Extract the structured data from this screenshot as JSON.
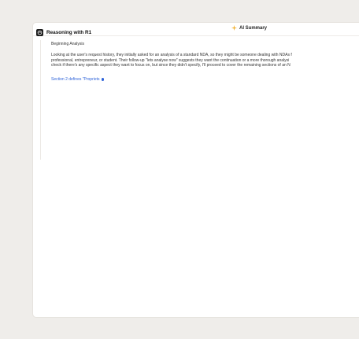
{
  "header": {
    "title": "AI Summary",
    "icon": "sparkle-icon",
    "icon_color": "#f2b233"
  },
  "reasoning": {
    "title": "Reasoning with R1",
    "icon": "deepseek-logo-icon",
    "step_title": "Beginning Analysis",
    "lines": [
      "Looking at the user's request history, they initially asked for an analysis of a standard NDA, so they might be someone dealing with NDAs f",
      "professional, entrepreneur, or student. Their follow-up \"lets analyse now\" suggests they want the continuation or a more thorough analysi",
      "check if there's any specific aspect they want to focus on, but since they didn't specify, I'll proceed to cover the remaining sections of an N"
    ],
    "streaming_text": "Section 2 defines \"Propriets",
    "streaming_color": "#2e63d9"
  }
}
